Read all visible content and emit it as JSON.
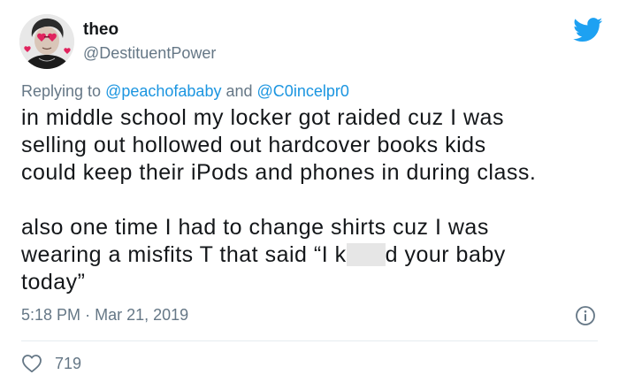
{
  "user": {
    "display_name": "theo",
    "handle": "@DestituentPower"
  },
  "reply": {
    "prefix": "Replying to",
    "mention_1": "@peachofababy",
    "conjunction": "and",
    "mention_2": "@C0incelpr0"
  },
  "tweet": {
    "paragraph_1_line_1": "in middle school my locker got raided cuz I was",
    "paragraph_1_line_2": "selling out hollowed out hardcover books kids",
    "paragraph_1_line_3": "could keep their iPods and phones in during class.",
    "paragraph_2_line_1": "also one time I had to change shirts cuz I was",
    "paragraph_2_line_2_before": "wearing a misfits T that said “I k",
    "paragraph_2_line_2_after": "d your baby",
    "paragraph_2_line_3": "today”"
  },
  "meta": {
    "time": "5:18 PM",
    "separator": "·",
    "date": "Mar 21, 2019"
  },
  "stats": {
    "likes": "719"
  },
  "icons": {
    "brand": "twitter-bird-icon",
    "info": "info-icon",
    "like": "heart-icon"
  },
  "colors": {
    "twitter_blue": "#1da1f2",
    "link_blue": "#1b95e0",
    "secondary_text": "#657786",
    "primary_text": "#14171a"
  }
}
